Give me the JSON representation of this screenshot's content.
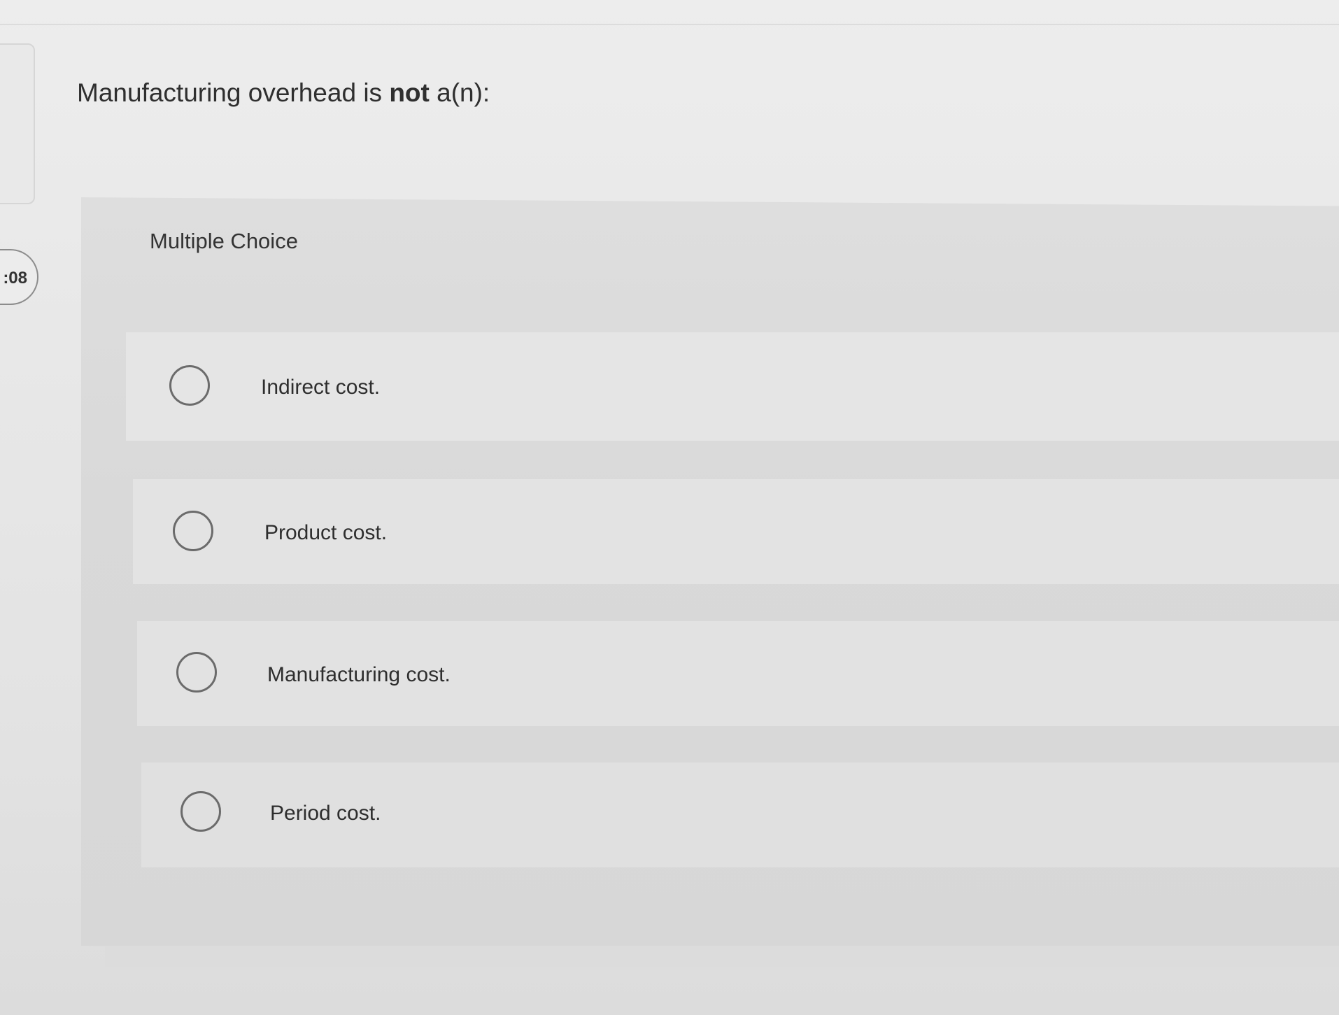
{
  "timer": {
    "text": ":08"
  },
  "question": {
    "prefix": "Manufacturing overhead is ",
    "emphasis": "not",
    "suffix": " a(n):"
  },
  "mc": {
    "label": "Multiple Choice"
  },
  "options": [
    {
      "label": "Indirect cost.",
      "selected": false
    },
    {
      "label": "Product cost.",
      "selected": false
    },
    {
      "label": "Manufacturing cost.",
      "selected": false
    },
    {
      "label": "Period cost.",
      "selected": false
    }
  ]
}
